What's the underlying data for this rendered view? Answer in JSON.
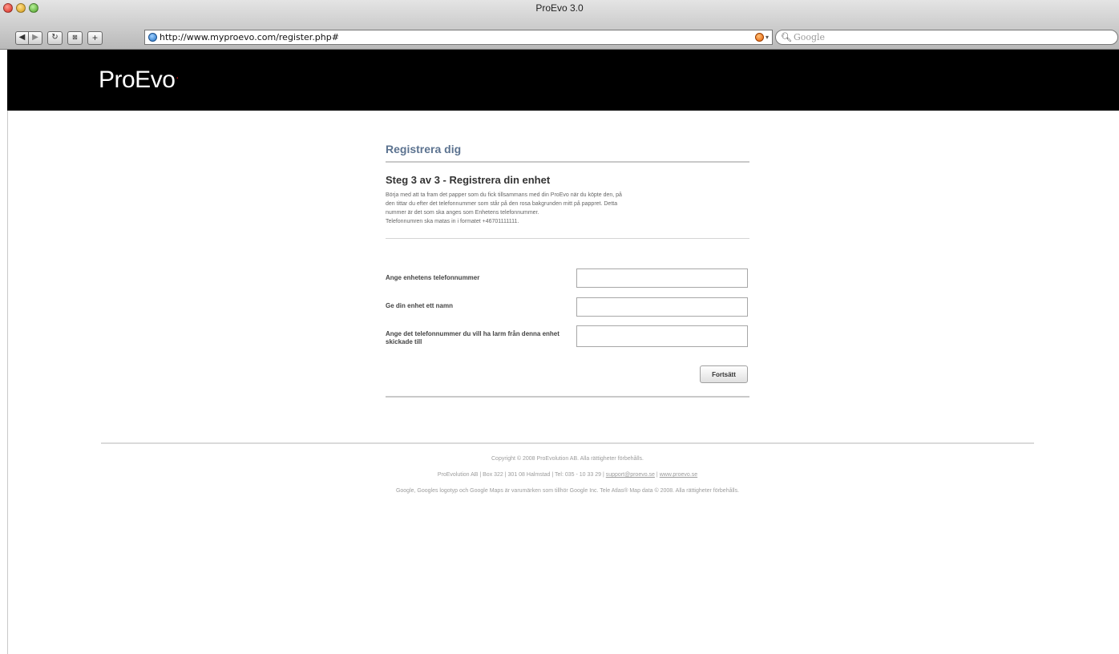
{
  "browser": {
    "window_title": "ProEvo 3.0",
    "url": "http://www.myproevo.com/register.php#",
    "search_placeholder": "Google",
    "back_icon": "back-arrow-icon",
    "forward_icon": "forward-arrow-icon",
    "reload_icon": "reload-icon",
    "add_icon": "plus-icon"
  },
  "header": {
    "logo_text": "ProEvo",
    "logo_mark": "."
  },
  "main": {
    "page_title": "Registrera dig",
    "step_title": "Steg 3 av 3 - Registrera din enhet",
    "intro_lines": [
      "Börja med att ta fram det papper som du fick tillsammans med din ProEvo när du köpte den, på",
      "den tittar du efter det telefonnummer som står på den rosa bakgrunden mitt på pappret. Detta",
      "nummer är det som ska anges som Enhetens telefonnummer.",
      "Telefonnumren ska matas in i formatet +46701111111."
    ],
    "fields": [
      {
        "label": "Ange enhetens telefonnummer",
        "value": ""
      },
      {
        "label": "Ge din enhet ett namn",
        "value": ""
      },
      {
        "label": "Ange det telefonnummer du vill ha larm från denna enhet skickade till",
        "value": ""
      }
    ],
    "submit_label": "Fortsätt"
  },
  "footer": {
    "copyright": "Copyright © 2008 ProEvolution AB. Alla rättigheter förbehålls.",
    "address": "ProEvolution AB | Box 322 | 301 08 Halmstad | Tel: 035 - 10 33 29 |",
    "email": "support@proevo.se",
    "separator": "|",
    "website": "www.proevo.se",
    "maps_notice": "Google, Googles logotyp och Google Maps är varumärken som tillhör Google Inc. Tele Atlas® Map data © 2008. Alla rättigheter förbehålls."
  },
  "colors": {
    "header_bg": "#000000",
    "title_color": "#5c7390",
    "logo_accent": "#e21d1d"
  }
}
